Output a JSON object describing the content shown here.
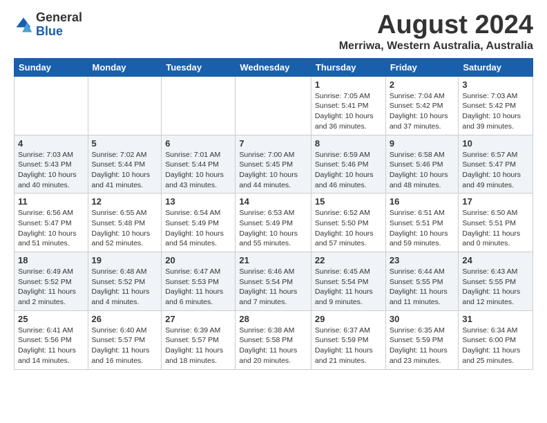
{
  "logo": {
    "general": "General",
    "blue": "Blue"
  },
  "title": "August 2024",
  "subtitle": "Merriwa, Western Australia, Australia",
  "days_of_week": [
    "Sunday",
    "Monday",
    "Tuesday",
    "Wednesday",
    "Thursday",
    "Friday",
    "Saturday"
  ],
  "weeks": [
    [
      {
        "day": "",
        "info": ""
      },
      {
        "day": "",
        "info": ""
      },
      {
        "day": "",
        "info": ""
      },
      {
        "day": "",
        "info": ""
      },
      {
        "day": "1",
        "info": "Sunrise: 7:05 AM\nSunset: 5:41 PM\nDaylight: 10 hours and 36 minutes."
      },
      {
        "day": "2",
        "info": "Sunrise: 7:04 AM\nSunset: 5:42 PM\nDaylight: 10 hours and 37 minutes."
      },
      {
        "day": "3",
        "info": "Sunrise: 7:03 AM\nSunset: 5:42 PM\nDaylight: 10 hours and 39 minutes."
      }
    ],
    [
      {
        "day": "4",
        "info": "Sunrise: 7:03 AM\nSunset: 5:43 PM\nDaylight: 10 hours and 40 minutes."
      },
      {
        "day": "5",
        "info": "Sunrise: 7:02 AM\nSunset: 5:44 PM\nDaylight: 10 hours and 41 minutes."
      },
      {
        "day": "6",
        "info": "Sunrise: 7:01 AM\nSunset: 5:44 PM\nDaylight: 10 hours and 43 minutes."
      },
      {
        "day": "7",
        "info": "Sunrise: 7:00 AM\nSunset: 5:45 PM\nDaylight: 10 hours and 44 minutes."
      },
      {
        "day": "8",
        "info": "Sunrise: 6:59 AM\nSunset: 5:46 PM\nDaylight: 10 hours and 46 minutes."
      },
      {
        "day": "9",
        "info": "Sunrise: 6:58 AM\nSunset: 5:46 PM\nDaylight: 10 hours and 48 minutes."
      },
      {
        "day": "10",
        "info": "Sunrise: 6:57 AM\nSunset: 5:47 PM\nDaylight: 10 hours and 49 minutes."
      }
    ],
    [
      {
        "day": "11",
        "info": "Sunrise: 6:56 AM\nSunset: 5:47 PM\nDaylight: 10 hours and 51 minutes."
      },
      {
        "day": "12",
        "info": "Sunrise: 6:55 AM\nSunset: 5:48 PM\nDaylight: 10 hours and 52 minutes."
      },
      {
        "day": "13",
        "info": "Sunrise: 6:54 AM\nSunset: 5:49 PM\nDaylight: 10 hours and 54 minutes."
      },
      {
        "day": "14",
        "info": "Sunrise: 6:53 AM\nSunset: 5:49 PM\nDaylight: 10 hours and 55 minutes."
      },
      {
        "day": "15",
        "info": "Sunrise: 6:52 AM\nSunset: 5:50 PM\nDaylight: 10 hours and 57 minutes."
      },
      {
        "day": "16",
        "info": "Sunrise: 6:51 AM\nSunset: 5:51 PM\nDaylight: 10 hours and 59 minutes."
      },
      {
        "day": "17",
        "info": "Sunrise: 6:50 AM\nSunset: 5:51 PM\nDaylight: 11 hours and 0 minutes."
      }
    ],
    [
      {
        "day": "18",
        "info": "Sunrise: 6:49 AM\nSunset: 5:52 PM\nDaylight: 11 hours and 2 minutes."
      },
      {
        "day": "19",
        "info": "Sunrise: 6:48 AM\nSunset: 5:52 PM\nDaylight: 11 hours and 4 minutes."
      },
      {
        "day": "20",
        "info": "Sunrise: 6:47 AM\nSunset: 5:53 PM\nDaylight: 11 hours and 6 minutes."
      },
      {
        "day": "21",
        "info": "Sunrise: 6:46 AM\nSunset: 5:54 PM\nDaylight: 11 hours and 7 minutes."
      },
      {
        "day": "22",
        "info": "Sunrise: 6:45 AM\nSunset: 5:54 PM\nDaylight: 11 hours and 9 minutes."
      },
      {
        "day": "23",
        "info": "Sunrise: 6:44 AM\nSunset: 5:55 PM\nDaylight: 11 hours and 11 minutes."
      },
      {
        "day": "24",
        "info": "Sunrise: 6:43 AM\nSunset: 5:55 PM\nDaylight: 11 hours and 12 minutes."
      }
    ],
    [
      {
        "day": "25",
        "info": "Sunrise: 6:41 AM\nSunset: 5:56 PM\nDaylight: 11 hours and 14 minutes."
      },
      {
        "day": "26",
        "info": "Sunrise: 6:40 AM\nSunset: 5:57 PM\nDaylight: 11 hours and 16 minutes."
      },
      {
        "day": "27",
        "info": "Sunrise: 6:39 AM\nSunset: 5:57 PM\nDaylight: 11 hours and 18 minutes."
      },
      {
        "day": "28",
        "info": "Sunrise: 6:38 AM\nSunset: 5:58 PM\nDaylight: 11 hours and 20 minutes."
      },
      {
        "day": "29",
        "info": "Sunrise: 6:37 AM\nSunset: 5:59 PM\nDaylight: 11 hours and 21 minutes."
      },
      {
        "day": "30",
        "info": "Sunrise: 6:35 AM\nSunset: 5:59 PM\nDaylight: 11 hours and 23 minutes."
      },
      {
        "day": "31",
        "info": "Sunrise: 6:34 AM\nSunset: 6:00 PM\nDaylight: 11 hours and 25 minutes."
      }
    ]
  ]
}
